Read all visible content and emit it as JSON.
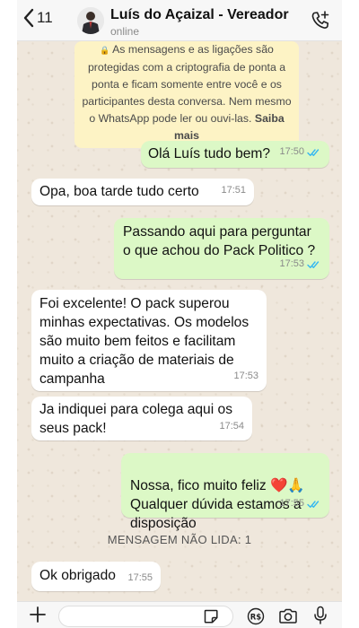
{
  "header": {
    "back_count": "11",
    "contact_name": "Luís do Açaizal - Vereador",
    "status": "online"
  },
  "notice": {
    "text": "As mensagens e as ligações são protegidas com a criptografia de ponta a ponta e ficam somente entre você e os participantes desta conversa. Nem mesmo o WhatsApp pode ler ou ouvi-las.",
    "more": "Saiba mais"
  },
  "messages": [
    {
      "dir": "out",
      "text": "Olá Luís tudo bem?",
      "time": "17:50",
      "read": true
    },
    {
      "dir": "in",
      "text": "Opa, boa tarde tudo certo",
      "time": "17:51"
    },
    {
      "dir": "out",
      "text": "Passando aqui para perguntar o que achou do Pack Politico ?",
      "time": "17:53",
      "read": true
    },
    {
      "dir": "in",
      "text": "Foi excelente! O pack superou minhas expectativas. Os modelos são muito bem feitos e facilitam muito a criação de materiais de campanha",
      "time": "17:53"
    },
    {
      "dir": "in",
      "text": "Ja indiquei para colega aqui os seus pack!",
      "time": "17:54"
    },
    {
      "dir": "out",
      "text": "Nossa, fico muito feliz ❤️🙏\nQualquer dúvida estamos a disposição",
      "time": "17:55",
      "read": true
    },
    {
      "dir": "in",
      "text": "Ok obrigado",
      "time": "17:55"
    }
  ],
  "unread_label": "MENSAGEM NÃO LIDA: 1",
  "composer": {
    "value": "",
    "placeholder": ""
  },
  "colors": {
    "outgoing_bubble": "#dcf8c6",
    "incoming_bubble": "#ffffff",
    "read_ticks": "#34b7f1",
    "notice_bg": "#fdf3c5"
  },
  "icons": [
    "back-chevron-icon",
    "add-call-icon",
    "plus-icon",
    "sticker-icon",
    "pay-icon",
    "camera-icon",
    "microphone-icon",
    "lock-icon",
    "double-check-icon"
  ]
}
